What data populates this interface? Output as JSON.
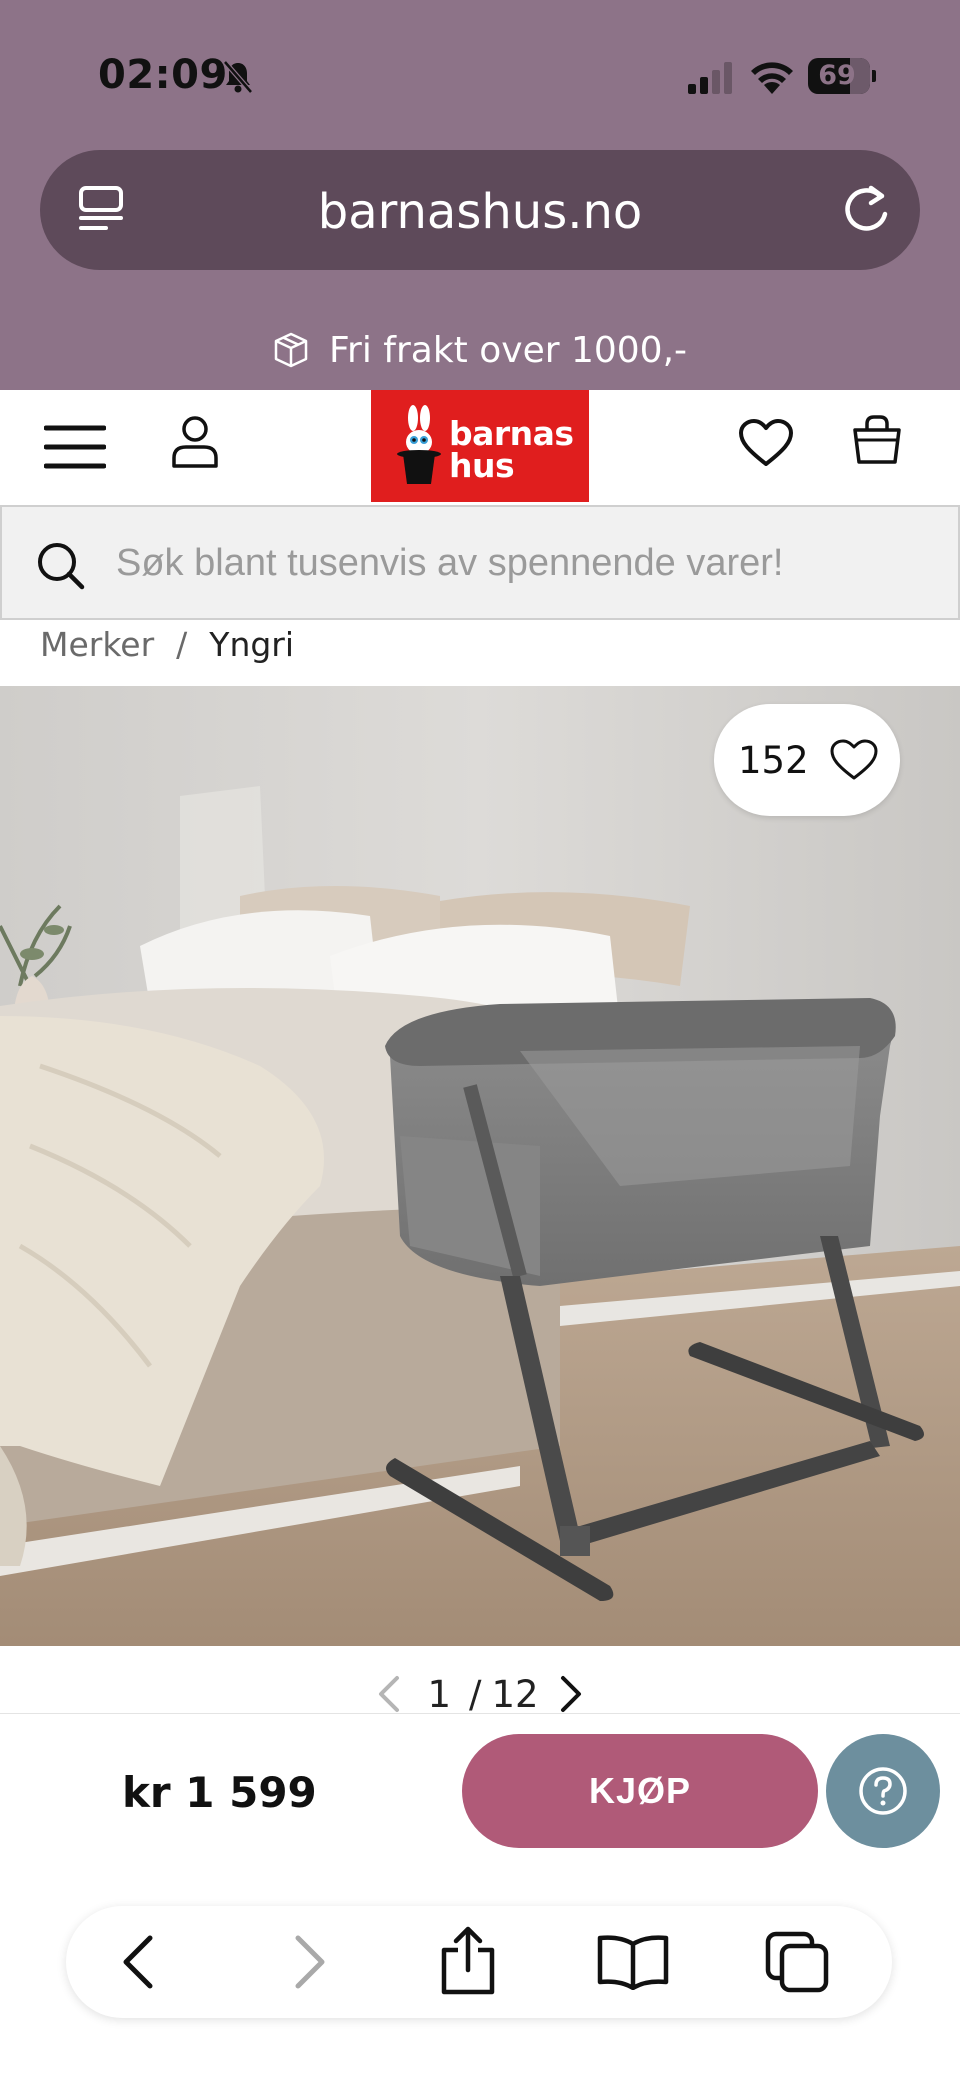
{
  "status_bar": {
    "time": "02:09",
    "battery": "69",
    "icons": [
      "bell-slash-icon",
      "signal-icon",
      "wifi-icon",
      "battery-icon"
    ]
  },
  "browser": {
    "url": "barnashus.no",
    "url_bar_icons": [
      "tabs-overview-icon",
      "reload-icon"
    ],
    "toolbar_icons": [
      "back-icon",
      "forward-icon",
      "share-icon",
      "bookmarks-icon",
      "tabs-icon"
    ]
  },
  "promo": {
    "icon": "package-icon",
    "text": "Fri frakt over 1000,-"
  },
  "header": {
    "logo_line1": "barnas",
    "logo_line2": "hus",
    "icons": [
      "menu-icon",
      "user-icon",
      "heart-icon",
      "shopping-bag-icon"
    ]
  },
  "search": {
    "placeholder": "Søk blant tusenvis av spennende varer!"
  },
  "breadcrumb": {
    "items": [
      "Merker",
      "Yngri"
    ],
    "separator": "/"
  },
  "product": {
    "likes": "152",
    "pager": {
      "current": "1",
      "total": "12",
      "separator": "/"
    },
    "price": "kr 1 599",
    "buy_label": "KJØP"
  },
  "colors": {
    "top_bar": "#8d7388",
    "url_bar": "#5e4a5a",
    "logo_bg": "#e01e1e",
    "buy_button": "#b05a78",
    "help_button": "#6d8f9e"
  }
}
